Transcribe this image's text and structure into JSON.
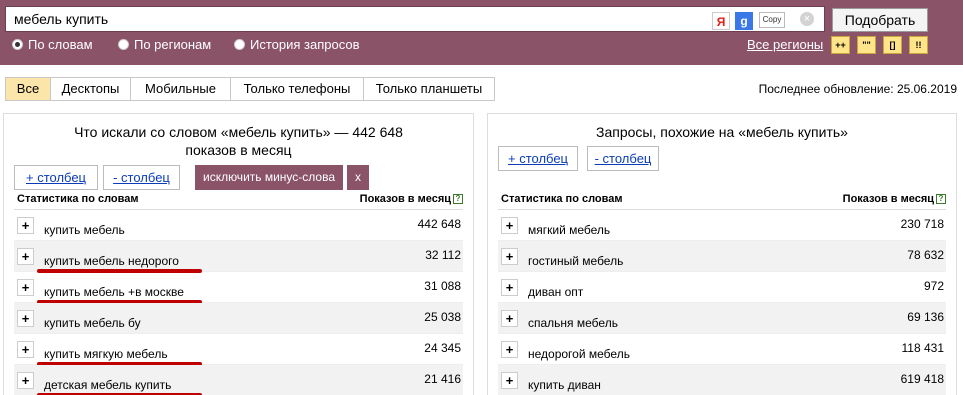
{
  "search": {
    "value": "мебель купить",
    "copy_label": "Copy",
    "clear_glyph": "⊗",
    "submit_label": "Подобрать",
    "yandex_glyph": "Я",
    "google_glyph": "g"
  },
  "radios": {
    "by_words": "По словам",
    "by_regions": "По регионам",
    "history": "История запросов"
  },
  "all_regions": "Все регионы",
  "modes": {
    "plusplus": "++",
    "quotes": "\"\"",
    "brackets": "[]",
    "excl": "!!"
  },
  "tabs": {
    "all": "Все",
    "desktop": "Десктопы",
    "mobile": "Мобильные",
    "phones": "Только телефоны",
    "tablets": "Только планшеты"
  },
  "last_update": "Последнее обновление: 25.06.2019",
  "left": {
    "title_line1": "Что искали со словом «мебель купить» — 442 648",
    "title_line2": "показов в месяц",
    "add_col": "+ столбец",
    "remove_col": "- столбец",
    "exclude_minus": "исключить минус-слова",
    "exclude_close": "x",
    "header_words": "Статистика по словам",
    "header_count": "Показов в месяц",
    "rows": [
      {
        "text": "купить мебель",
        "count": "442 648"
      },
      {
        "text": "купить мебель недорого",
        "count": "32 112"
      },
      {
        "text": "купить мебель +в москве",
        "count": "31 088"
      },
      {
        "text": "купить мебель бу",
        "count": "25 038"
      },
      {
        "text": "купить мягкую мебель",
        "count": "24 345"
      },
      {
        "text": "детская мебель купить",
        "count": "21 416"
      }
    ]
  },
  "right": {
    "title": "Запросы, похожие на «мебель купить»",
    "add_col": "+ столбец",
    "remove_col": "- столбец",
    "header_words": "Статистика по словам",
    "header_count": "Показов в месяц",
    "rows": [
      {
        "text": "мягкий мебель",
        "count": "230 718"
      },
      {
        "text": "гостиный мебель",
        "count": "78 632"
      },
      {
        "text": "диван опт",
        "count": "972"
      },
      {
        "text": "спальня мебель",
        "count": "69 136"
      },
      {
        "text": "недорогой мебель",
        "count": "118 431"
      },
      {
        "text": "купить диван",
        "count": "619 418"
      }
    ]
  },
  "plus_glyph": "+",
  "help_glyph": "?"
}
